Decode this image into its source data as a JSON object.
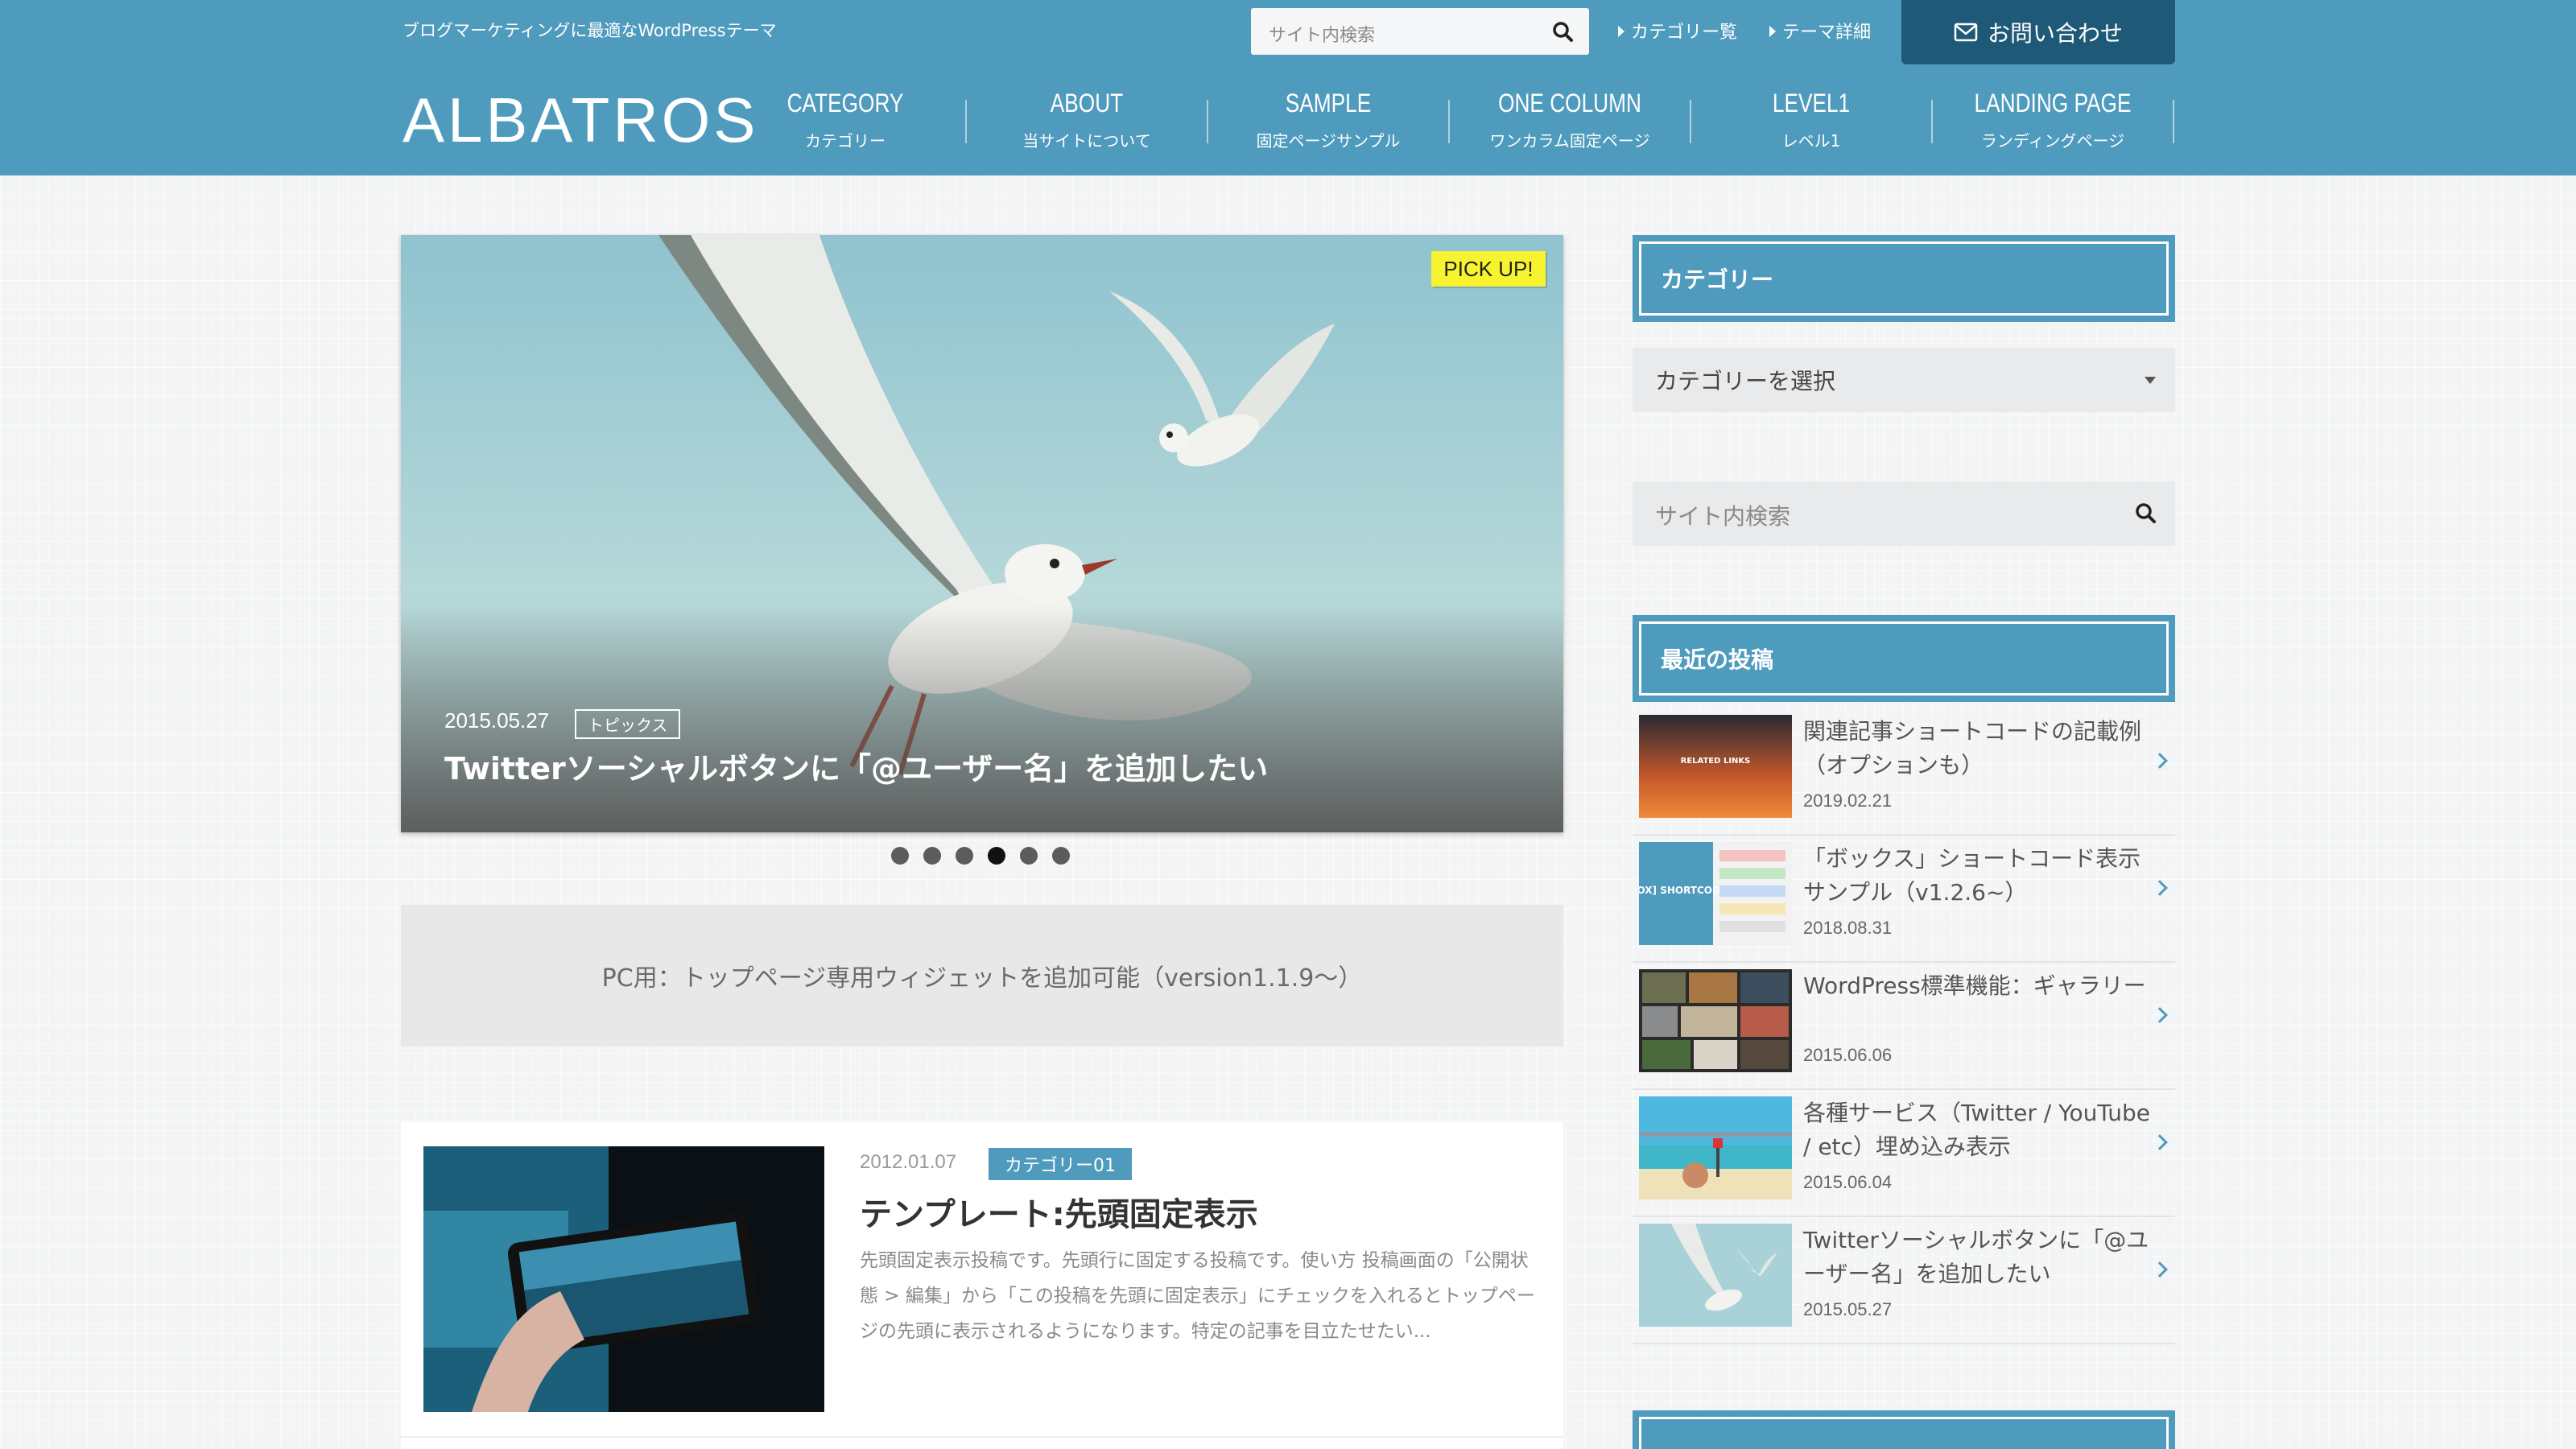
{
  "header": {
    "tagline": "ブログマーケティングに最適なWordPressテーマ",
    "search_placeholder": "サイト内検索",
    "links": [
      "カテゴリー覧",
      "テーマ詳細"
    ],
    "contact_label": "お問い合わせ",
    "logo": "ALBATROS",
    "nav": [
      {
        "en": "CATEGORY",
        "jp": "カテゴリー"
      },
      {
        "en": "ABOUT",
        "jp": "当サイトについて"
      },
      {
        "en": "SAMPLE",
        "jp": "固定ページサンプル"
      },
      {
        "en": "ONE COLUMN",
        "jp": "ワンカラム固定ページ"
      },
      {
        "en": "LEVEL1",
        "jp": "レベル1"
      },
      {
        "en": "LANDING PAGE",
        "jp": "ランディングページ"
      }
    ]
  },
  "slider": {
    "badge": "PICK UP!",
    "date": "2015.05.27",
    "category": "トピックス",
    "title": "Twitterソーシャルボタンに「@ユーザー名」を追加したい",
    "dot_count": 6,
    "active_dot": 4
  },
  "widget_notice": "PC用：トップページ専用ウィジェットを追加可能（version1.1.9〜）",
  "post": {
    "date": "2012.01.07",
    "category": "カテゴリー01",
    "title": "テンプレート:先頭固定表示",
    "excerpt": "先頭固定表示投稿です。先頭行に固定する投稿です。使い方 投稿画面の「公開状態 > 編集」から「この投稿を先頭に固定表示」にチェックを入れるとトップページの先頭に表示されるようになります。特定の記事を目立たせたい..."
  },
  "sidebar": {
    "category_title": "カテゴリー",
    "category_select": "カテゴリーを選択",
    "search_placeholder": "サイト内検索",
    "recent_title": "最近の投稿",
    "recent": [
      {
        "title": "関連記事ショートコードの記載例（オプションも）",
        "date": "2019.02.21",
        "thumb_text": "RELATED LINKS"
      },
      {
        "title": "「ボックス」ショートコード表示サンプル（v1.2.6~）",
        "date": "2018.08.31",
        "thumb_text": "[BOX] SHORTCODE"
      },
      {
        "title": "WordPress標準機能：ギャラリー",
        "date": "2015.06.06"
      },
      {
        "title": "各種サービス（Twitter / YouTube / etc）埋め込み表示",
        "date": "2015.06.04"
      },
      {
        "title": "Twitterソーシャルボタンに「@ユーザー名」を追加したい",
        "date": "2015.05.27"
      }
    ]
  },
  "colors": {
    "accent": "#4f9bbd",
    "contact": "#1e5a78",
    "badge": "#f7f32e"
  }
}
